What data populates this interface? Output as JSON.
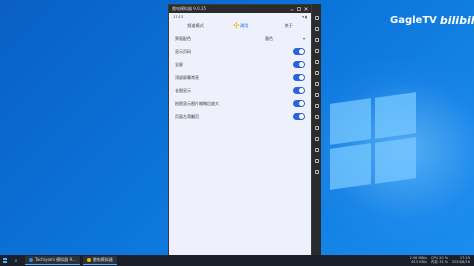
{
  "brand": {
    "name": "GagleTV",
    "mark": "bilibili"
  },
  "emulator": {
    "title": "雷电模拟器 9.0.35",
    "controls": [
      "minimize-icon",
      "maximize-icon",
      "close-icon"
    ],
    "status_left": "17:13",
    "status_right": "▾ ▮",
    "tabs": [
      {
        "label": "频道模式"
      },
      {
        "label": "通用"
      },
      {
        "label": "关于"
      }
    ],
    "settings": [
      {
        "label": "界面配色",
        "value": "墨色",
        "control": "dropdown"
      },
      {
        "label": "显示页码",
        "control": "toggle",
        "on": true
      },
      {
        "label": "全屏",
        "control": "toggle",
        "on": true
      },
      {
        "label": "顶部屏幕常亮",
        "control": "toggle",
        "on": true
      },
      {
        "label": "长图显示",
        "control": "toggle",
        "on": true
      },
      {
        "label": "拍照显示图片缩略后放大",
        "control": "toggle",
        "on": true
      },
      {
        "label": "页面左滑翻页",
        "control": "toggle",
        "on": true
      }
    ],
    "side_icons": [
      "settings-icon",
      "keyboard-icon",
      "screenshot-icon",
      "volume-up-icon",
      "volume-down-icon",
      "fullscreen-icon",
      "rotate-icon",
      "record-icon",
      "folder-icon",
      "install-apk-icon",
      "multi-instance-icon",
      "sync-icon",
      "more-icon",
      "back-icon",
      "home-icon"
    ]
  },
  "taskbar": {
    "apps": [
      {
        "label": "Tachiyomi 模拟器 9...",
        "color": "#2b8be8"
      },
      {
        "label": "雷电模拟器",
        "color": "#f0b400"
      }
    ],
    "net_up": "2.56 MB/s",
    "net_down": "613 KB/s",
    "cpu": "CPU 20 %",
    "mem": "内存 35 %",
    "time": "17:15",
    "date": "2023/8/16"
  }
}
